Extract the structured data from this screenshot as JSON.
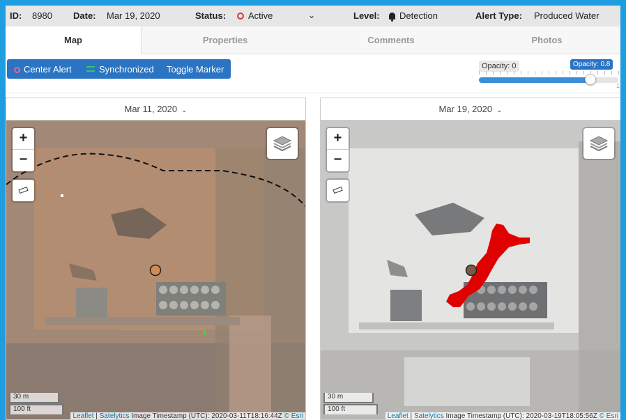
{
  "header": {
    "id_label": "ID:",
    "id_value": "8980",
    "date_label": "Date:",
    "date_value": "Mar 19, 2020",
    "status_label": "Status:",
    "status_value": "Active",
    "level_label": "Level:",
    "level_value": "Detection",
    "alert_type_label": "Alert Type:",
    "alert_type_value": "Produced Water"
  },
  "tabs": [
    {
      "label": "Map",
      "active": true
    },
    {
      "label": "Properties",
      "active": false
    },
    {
      "label": "Comments",
      "active": false
    },
    {
      "label": "Photos",
      "active": false
    }
  ],
  "toolbar": {
    "center_alert": "Center Alert",
    "synchronized": "Synchronized",
    "toggle_marker": "Toggle Marker"
  },
  "opacity": {
    "min_label": "Opacity: 0",
    "current_label": "Opacity: 0.8",
    "value": 0.8,
    "max_label": "1"
  },
  "left_map": {
    "date": "Mar 11, 2020",
    "scale_m": "30 m",
    "scale_ft": "100 ft",
    "attrib_leaflet": "Leaflet",
    "attrib_sep": "|",
    "attrib_satelytics": "Satelytics",
    "attrib_text": "Image Timestamp (UTC): 2020-03-11T18:16:44Z",
    "attrib_esri": "© Esri"
  },
  "right_map": {
    "date": "Mar 19, 2020",
    "scale_m": "30 m",
    "scale_ft": "100 ft",
    "attrib_leaflet": "Leaflet",
    "attrib_sep": "|",
    "attrib_satelytics": "Satelytics",
    "attrib_text": "Image Timestamp (UTC): 2020-03-19T18:05:56Z",
    "attrib_esri": "© Esri"
  },
  "map_controls": {
    "zoom_in": "+",
    "zoom_out": "−"
  },
  "colors": {
    "accent": "#2a74c3",
    "frame": "#1e9ee0",
    "status": "#d33333",
    "spill": "#e00000",
    "sync": "#36c46a"
  },
  "icons": [
    "status-circle-icon",
    "chevron-down-icon",
    "bell-icon",
    "crosshair-icon",
    "sync-icon",
    "ruler-icon",
    "layers-icon"
  ]
}
